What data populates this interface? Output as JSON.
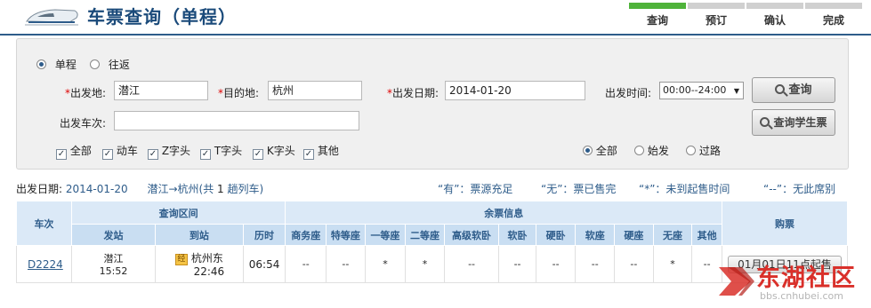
{
  "header": {
    "title": "车票查询（单程）",
    "steps": [
      "查询",
      "预订",
      "确认",
      "完成"
    ]
  },
  "trip_type": {
    "one_way": "单程",
    "round_trip": "往返"
  },
  "form": {
    "from_label": "出发地:",
    "from_value": "潜江",
    "to_label": "目的地:",
    "to_value": "杭州",
    "date_label": "出发日期:",
    "date_value": "2014-01-20",
    "time_label": "出发时间:",
    "time_value": "00:00--24:00",
    "train_no_label": "出发车次:",
    "train_no_value": "",
    "search_button": "查询",
    "student_button": "查询学生票"
  },
  "train_types": [
    "全部",
    "动车",
    "Z字头",
    "T字头",
    "K字头",
    "其他"
  ],
  "station_filter": [
    "全部",
    "始发",
    "过路"
  ],
  "summary": {
    "date_label": "出发日期:",
    "date": "2014-01-20",
    "route": "潜江→杭州",
    "count_prefix": "(共",
    "count": "1",
    "count_suffix": "趟列车)",
    "legend": [
      "“有”：票源充足",
      "“无”：票已售完",
      "“*”：未到起售时间",
      "“--”：无此席别"
    ]
  },
  "table": {
    "headers": {
      "train": "车次",
      "interval": "查询区间",
      "tickets": "余票信息",
      "buy": "购票",
      "depart": "发站",
      "arrive": "到站",
      "duration": "历时",
      "seats": [
        "商务座",
        "特等座",
        "一等座",
        "二等座",
        "高级软卧",
        "软卧",
        "硬卧",
        "软座",
        "硬座",
        "无座",
        "其他"
      ]
    },
    "rows": [
      {
        "train": "D2224",
        "from": "潜江",
        "depart_time": "15:52",
        "pass_badge": "经",
        "to": "杭州东",
        "arrive_time": "22:46",
        "duration": "06:54",
        "seats": [
          "--",
          "--",
          "*",
          "*",
          "--",
          "--",
          "--",
          "--",
          "--",
          "*",
          "--"
        ],
        "buy": "01月01日11点起售"
      }
    ]
  },
  "watermark": {
    "main": "东湖社区",
    "url": "bbs.cnhubei.com"
  },
  "colors": {
    "primary": "#2e5c8a",
    "active_step": "#4fb33a",
    "required": "#dd0000",
    "watermark": "#d9302a"
  }
}
